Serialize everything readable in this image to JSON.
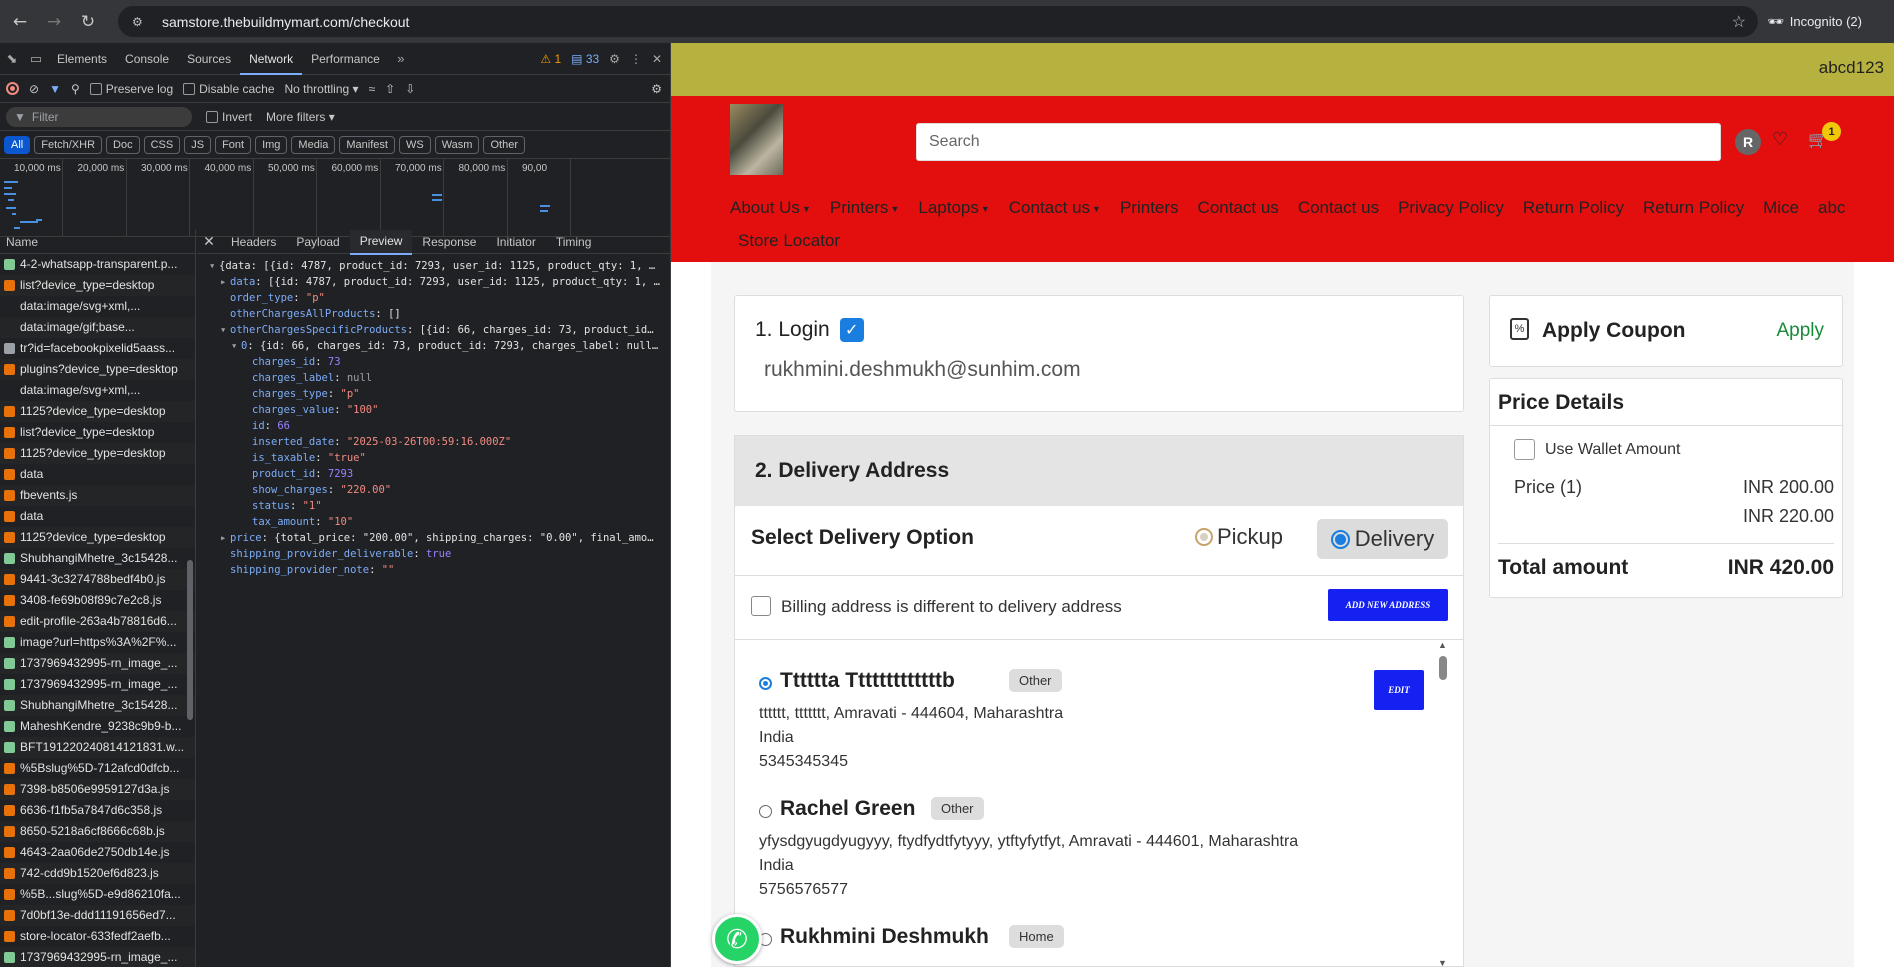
{
  "browser": {
    "url": "samstore.thebuildmymart.com/checkout",
    "incognito": "Incognito (2)"
  },
  "devtools": {
    "tabs": [
      "Elements",
      "Console",
      "Sources",
      "Network",
      "Performance"
    ],
    "active_tab": "Network",
    "warnings": "1",
    "messages": "33",
    "toolbar": {
      "preserve_log": "Preserve log",
      "disable_cache": "Disable cache",
      "throttling": "No throttling"
    },
    "filter": {
      "placeholder": "Filter",
      "invert": "Invert",
      "more_filters": "More filters"
    },
    "type_filters": [
      "All",
      "Fetch/XHR",
      "Doc",
      "CSS",
      "JS",
      "Font",
      "Img",
      "Media",
      "Manifest",
      "WS",
      "Wasm",
      "Other"
    ],
    "timeline_ticks": [
      "10,000 ms",
      "20,000 ms",
      "30,000 ms",
      "40,000 ms",
      "50,000 ms",
      "60,000 ms",
      "70,000 ms",
      "80,000 ms",
      "90,00"
    ],
    "name_header": "Name",
    "requests": [
      {
        "name": "4-2-whatsapp-transparent.p...",
        "type": "img"
      },
      {
        "name": "list?device_type=desktop",
        "type": "js"
      },
      {
        "name": "data:image/svg+xml,...",
        "type": "none"
      },
      {
        "name": "data:image/gif;base...",
        "type": "none"
      },
      {
        "name": "tr?id=facebookpixelid5aass...",
        "type": "doc"
      },
      {
        "name": "plugins?device_type=desktop",
        "type": "js"
      },
      {
        "name": "data:image/svg+xml,...",
        "type": "none"
      },
      {
        "name": "1125?device_type=desktop",
        "type": "js"
      },
      {
        "name": "list?device_type=desktop",
        "type": "js"
      },
      {
        "name": "1125?device_type=desktop",
        "type": "js"
      },
      {
        "name": "data",
        "type": "js"
      },
      {
        "name": "fbevents.js",
        "type": "js"
      },
      {
        "name": "data",
        "type": "js"
      },
      {
        "name": "1125?device_type=desktop",
        "type": "js"
      },
      {
        "name": "ShubhangiMhetre_3c15428...",
        "type": "img"
      },
      {
        "name": "9441-3c3274788bedf4b0.js",
        "type": "js"
      },
      {
        "name": "3408-fe69b08f89c7e2c8.js",
        "type": "js"
      },
      {
        "name": "edit-profile-263a4b78816d6...",
        "type": "js"
      },
      {
        "name": "image?url=https%3A%2F%...",
        "type": "img"
      },
      {
        "name": "1737969432995-rn_image_...",
        "type": "img"
      },
      {
        "name": "1737969432995-rn_image_...",
        "type": "img"
      },
      {
        "name": "ShubhangiMhetre_3c15428...",
        "type": "img"
      },
      {
        "name": "MaheshKendre_9238c9b9-b...",
        "type": "img"
      },
      {
        "name": "BFT191220240814121831.w...",
        "type": "img"
      },
      {
        "name": "%5Bslug%5D-712afcd0dfcb...",
        "type": "js"
      },
      {
        "name": "7398-b8506e9959127d3a.js",
        "type": "js"
      },
      {
        "name": "6636-f1fb5a7847d6c358.js",
        "type": "js"
      },
      {
        "name": "8650-5218a6cf8666c68b.js",
        "type": "js"
      },
      {
        "name": "4643-2aa06de2750db14e.js",
        "type": "js"
      },
      {
        "name": "742-cdd9b1520ef6d823.js",
        "type": "js"
      },
      {
        "name": "%5B...slug%5D-e9d86210fa...",
        "type": "js"
      },
      {
        "name": "7d0bf13e-ddd11191656ed7...",
        "type": "js"
      },
      {
        "name": "store-locator-633fedf2aefb...",
        "type": "js"
      },
      {
        "name": "1737969432995-rn_image_...",
        "type": "img"
      }
    ],
    "selected_request_index": 7,
    "preview_tabs": [
      "Headers",
      "Payload",
      "Preview",
      "Response",
      "Initiator",
      "Timing"
    ],
    "active_preview_tab": "Preview",
    "preview_lines": [
      {
        "indent": 0,
        "tri": "open",
        "text": "{data: [{id: 4787, product_id: 7293, user_id: 1125, product_qty: 1, …"
      },
      {
        "indent": 1,
        "tri": "closed",
        "key": "data",
        "text": "[{id: 4787, product_id: 7293, user_id: 1125, product_qty: 1, …"
      },
      {
        "indent": 1,
        "tri": "",
        "key": "order_type",
        "str": "\"p\""
      },
      {
        "indent": 1,
        "tri": "",
        "key": "otherChargesAllProducts",
        "text": "[]"
      },
      {
        "indent": 1,
        "tri": "open",
        "key": "otherChargesSpecificProducts",
        "text": "[{id: 66, charges_id: 73, product_id…"
      },
      {
        "indent": 2,
        "tri": "open",
        "key": "0",
        "text": "{id: 66, charges_id: 73, product_id: 7293, charges_label: null…"
      },
      {
        "indent": 3,
        "tri": "",
        "key": "charges_id",
        "num": "73"
      },
      {
        "indent": 3,
        "tri": "",
        "key": "charges_label",
        "nul": "null"
      },
      {
        "indent": 3,
        "tri": "",
        "key": "charges_type",
        "str": "\"p\""
      },
      {
        "indent": 3,
        "tri": "",
        "key": "charges_value",
        "str": "\"100\""
      },
      {
        "indent": 3,
        "tri": "",
        "key": "id",
        "num": "66"
      },
      {
        "indent": 3,
        "tri": "",
        "key": "inserted_date",
        "str": "\"2025-03-26T00:59:16.000Z\""
      },
      {
        "indent": 3,
        "tri": "",
        "key": "is_taxable",
        "str": "\"true\""
      },
      {
        "indent": 3,
        "tri": "",
        "key": "product_id",
        "num": "7293"
      },
      {
        "indent": 3,
        "tri": "",
        "key": "show_charges",
        "str": "\"220.00\""
      },
      {
        "indent": 3,
        "tri": "",
        "key": "status",
        "str": "\"1\""
      },
      {
        "indent": 3,
        "tri": "",
        "key": "tax_amount",
        "str": "\"10\""
      },
      {
        "indent": 1,
        "tri": "closed",
        "key": "price",
        "text": "{total_price: \"200.00\", shipping_charges: \"0.00\", final_amo…"
      },
      {
        "indent": 1,
        "tri": "",
        "key": "shipping_provider_deliverable",
        "num": "true"
      },
      {
        "indent": 1,
        "tri": "",
        "key": "shipping_provider_note",
        "str": "\"\""
      }
    ]
  },
  "site": {
    "username": "abcd123",
    "search_placeholder": "Search",
    "avatar_initial": "R",
    "cart_count": "1",
    "menu": [
      {
        "label": "About Us",
        "caret": true
      },
      {
        "label": "Printers",
        "caret": true
      },
      {
        "label": "Laptops",
        "caret": true
      },
      {
        "label": "Contact us",
        "caret": true
      },
      {
        "label": "Printers",
        "caret": false
      },
      {
        "label": "Contact us",
        "caret": false
      },
      {
        "label": "Contact us",
        "caret": false
      },
      {
        "label": "Privacy Policy",
        "caret": false
      },
      {
        "label": "Return Policy",
        "caret": false
      },
      {
        "label": "Return Policy",
        "caret": false
      },
      {
        "label": "Mice",
        "caret": false
      },
      {
        "label": "abc",
        "caret": false
      },
      {
        "label": "Store Locator",
        "caret": false
      }
    ],
    "login": {
      "title": "1. Login",
      "email": "rukhmini.deshmukh@sunhim.com"
    },
    "delivery": {
      "title": "2. Delivery Address",
      "option_title": "Select Delivery Option",
      "pickup": "Pickup",
      "delivery": "Delivery",
      "selected_option": "Delivery",
      "billing_label": "Billing address is different to delivery address",
      "add_new_address": "ADD NEW ADDRESS",
      "edit": "EDIT",
      "addresses": [
        {
          "name": "Tttttta Tttttttttttttb",
          "tag": "Other",
          "selected": true,
          "line1": "tttttt, ttttttt, Amravati - 444604, Maharashtra",
          "country": "India",
          "phone": "5345345345"
        },
        {
          "name": "Rachel Green",
          "tag": "Other",
          "selected": false,
          "line1": "yfysdgyugdyugyyy, ftydfydtfytyyy, ytftyfytfyt, Amravati - 444601, Maharashtra",
          "country": "India",
          "phone": "5756576577"
        },
        {
          "name": "Rukhmini Deshmukh",
          "tag": "Home",
          "selected": false
        }
      ]
    },
    "coupon": {
      "title": "Apply Coupon",
      "apply": "Apply"
    },
    "price_details": {
      "title": "Price Details",
      "wallet_label": "Use Wallet Amount",
      "price_label": "Price (1)",
      "price_value": "INR 200.00",
      "extra_value": "INR 220.00",
      "total_label": "Total amount",
      "total_value": "INR 420.00"
    }
  }
}
